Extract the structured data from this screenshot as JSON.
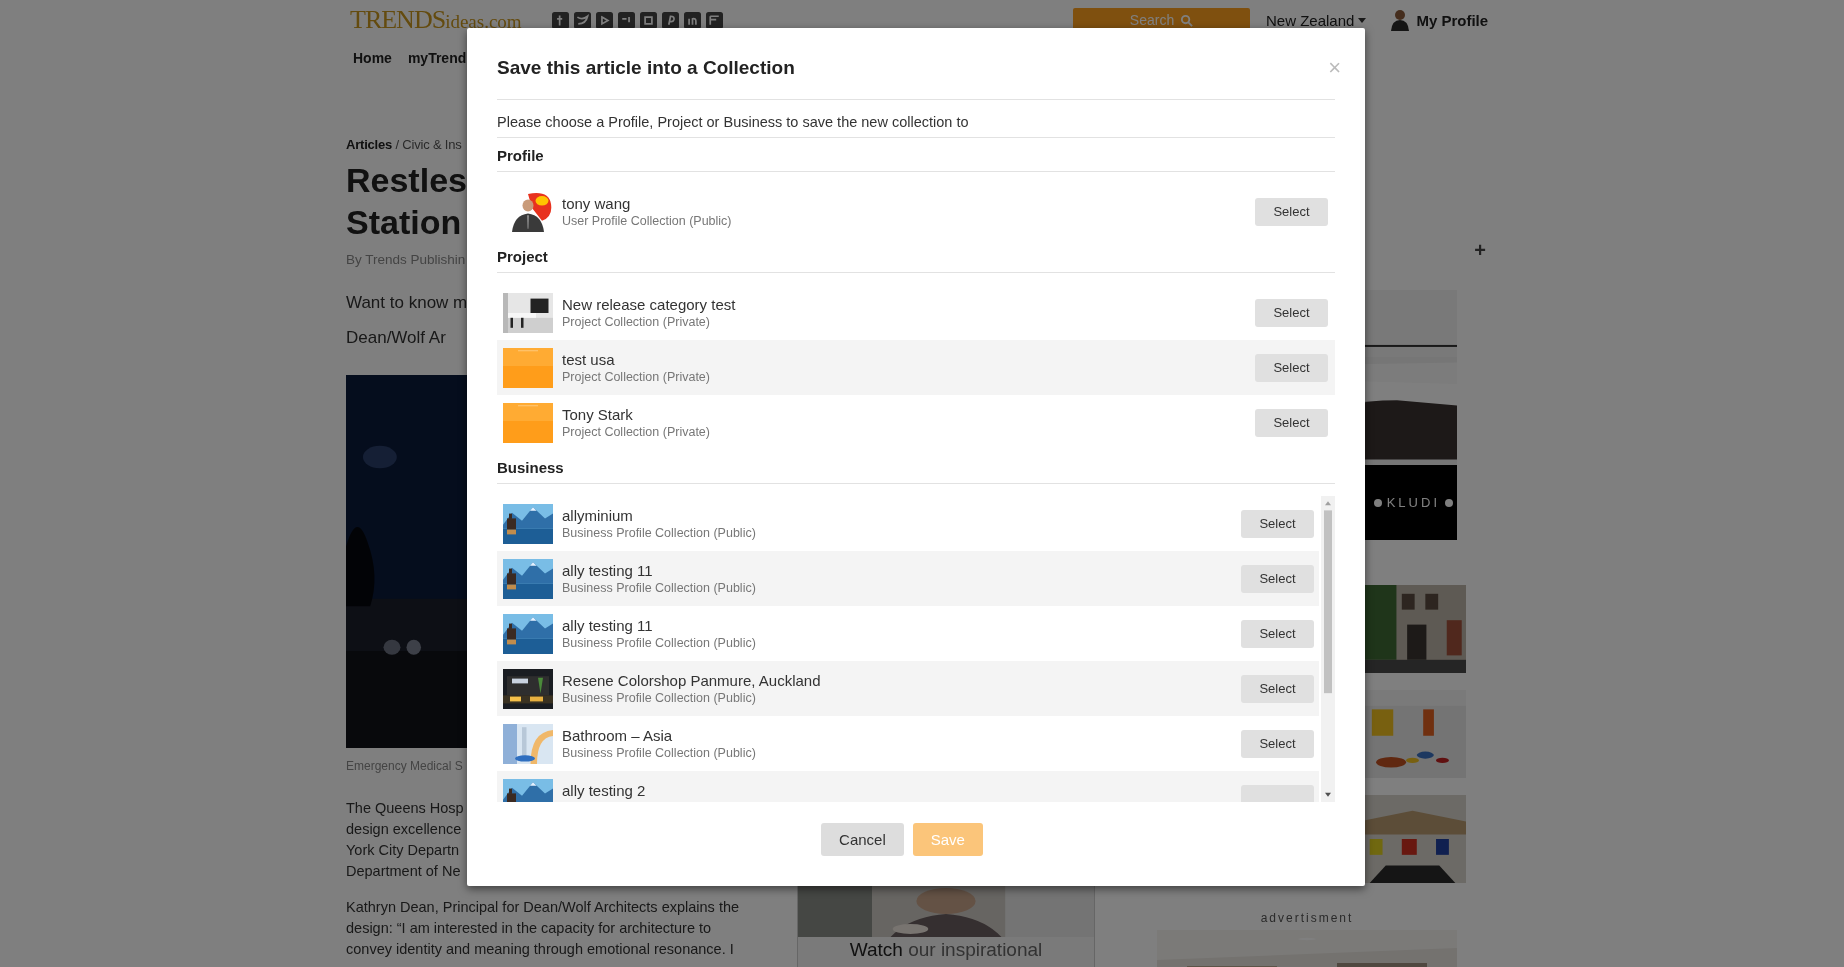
{
  "header": {
    "logo": {
      "main": "TRENDS",
      "suffix": "ideas.com"
    },
    "search": "Search",
    "region": "New Zealand",
    "profile": "My Profile"
  },
  "nav": [
    "Home",
    "myTrend"
  ],
  "article": {
    "breadcrumb": "**Articles** / Civic & Ins",
    "title_lines": [
      "Restles",
      "Station"
    ],
    "byline": "By Trends Publishin",
    "intro_lines": [
      "Want to know m",
      "Dean/Wolf Ar"
    ],
    "caption": "Emergency Medical S",
    "paragraphs": [
      [
        "The Queens Hosp",
        "design excellence",
        "York City Departn",
        "Department of Ne"
      ],
      [
        "Kathryn Dean, Principal for Dean/Wolf Architects explains the",
        "design: “I am interested in the capacity for architecture to",
        "convey identity and meaning through emotional resonance. I"
      ]
    ]
  },
  "video": {
    "lead": "Watch",
    "rest": "our inspirational"
  },
  "sidebar": {
    "plus": "+",
    "ad_brand": "KLUDI",
    "ad_label": "advertisment"
  },
  "modal": {
    "title": "Save this article into a Collection",
    "close": "×",
    "intro": "Please choose a Profile, Project or Business to save the new collection to",
    "sections": [
      {
        "heading": "Profile",
        "scrollable": false,
        "items": [
          {
            "name": "tony wang",
            "sub": "User Profile Collection (Public)",
            "button": "Select"
          }
        ]
      },
      {
        "heading": "Project",
        "scrollable": false,
        "items": [
          {
            "name": "New release category test",
            "sub": "Project Collection (Private)",
            "button": "Select"
          },
          {
            "name": "test usa",
            "sub": "Project Collection (Private)",
            "button": "Select"
          },
          {
            "name": "Tony Stark",
            "sub": "Project Collection (Private)",
            "button": "Select"
          }
        ]
      },
      {
        "heading": "Business",
        "scrollable": true,
        "items": [
          {
            "name": "allyminium",
            "sub": "Business Profile Collection (Public)",
            "button": "Select"
          },
          {
            "name": "ally testing 11",
            "sub": "Business Profile Collection (Public)",
            "button": "Select"
          },
          {
            "name": "ally testing 11",
            "sub": "Business Profile Collection (Public)",
            "button": "Select"
          },
          {
            "name": "Resene Colorshop Panmure, Auckland",
            "sub": "Business Profile Collection (Public)",
            "button": "Select"
          },
          {
            "name": "Bathroom – Asia",
            "sub": "Business Profile Collection (Public)",
            "button": "Select"
          },
          {
            "name": "ally testing 2"
          }
        ]
      }
    ],
    "buttons": [
      {
        "label": "Cancel",
        "kind": "secondary",
        "disabled": false
      },
      {
        "label": "Save",
        "kind": "primary",
        "disabled": true
      }
    ]
  }
}
